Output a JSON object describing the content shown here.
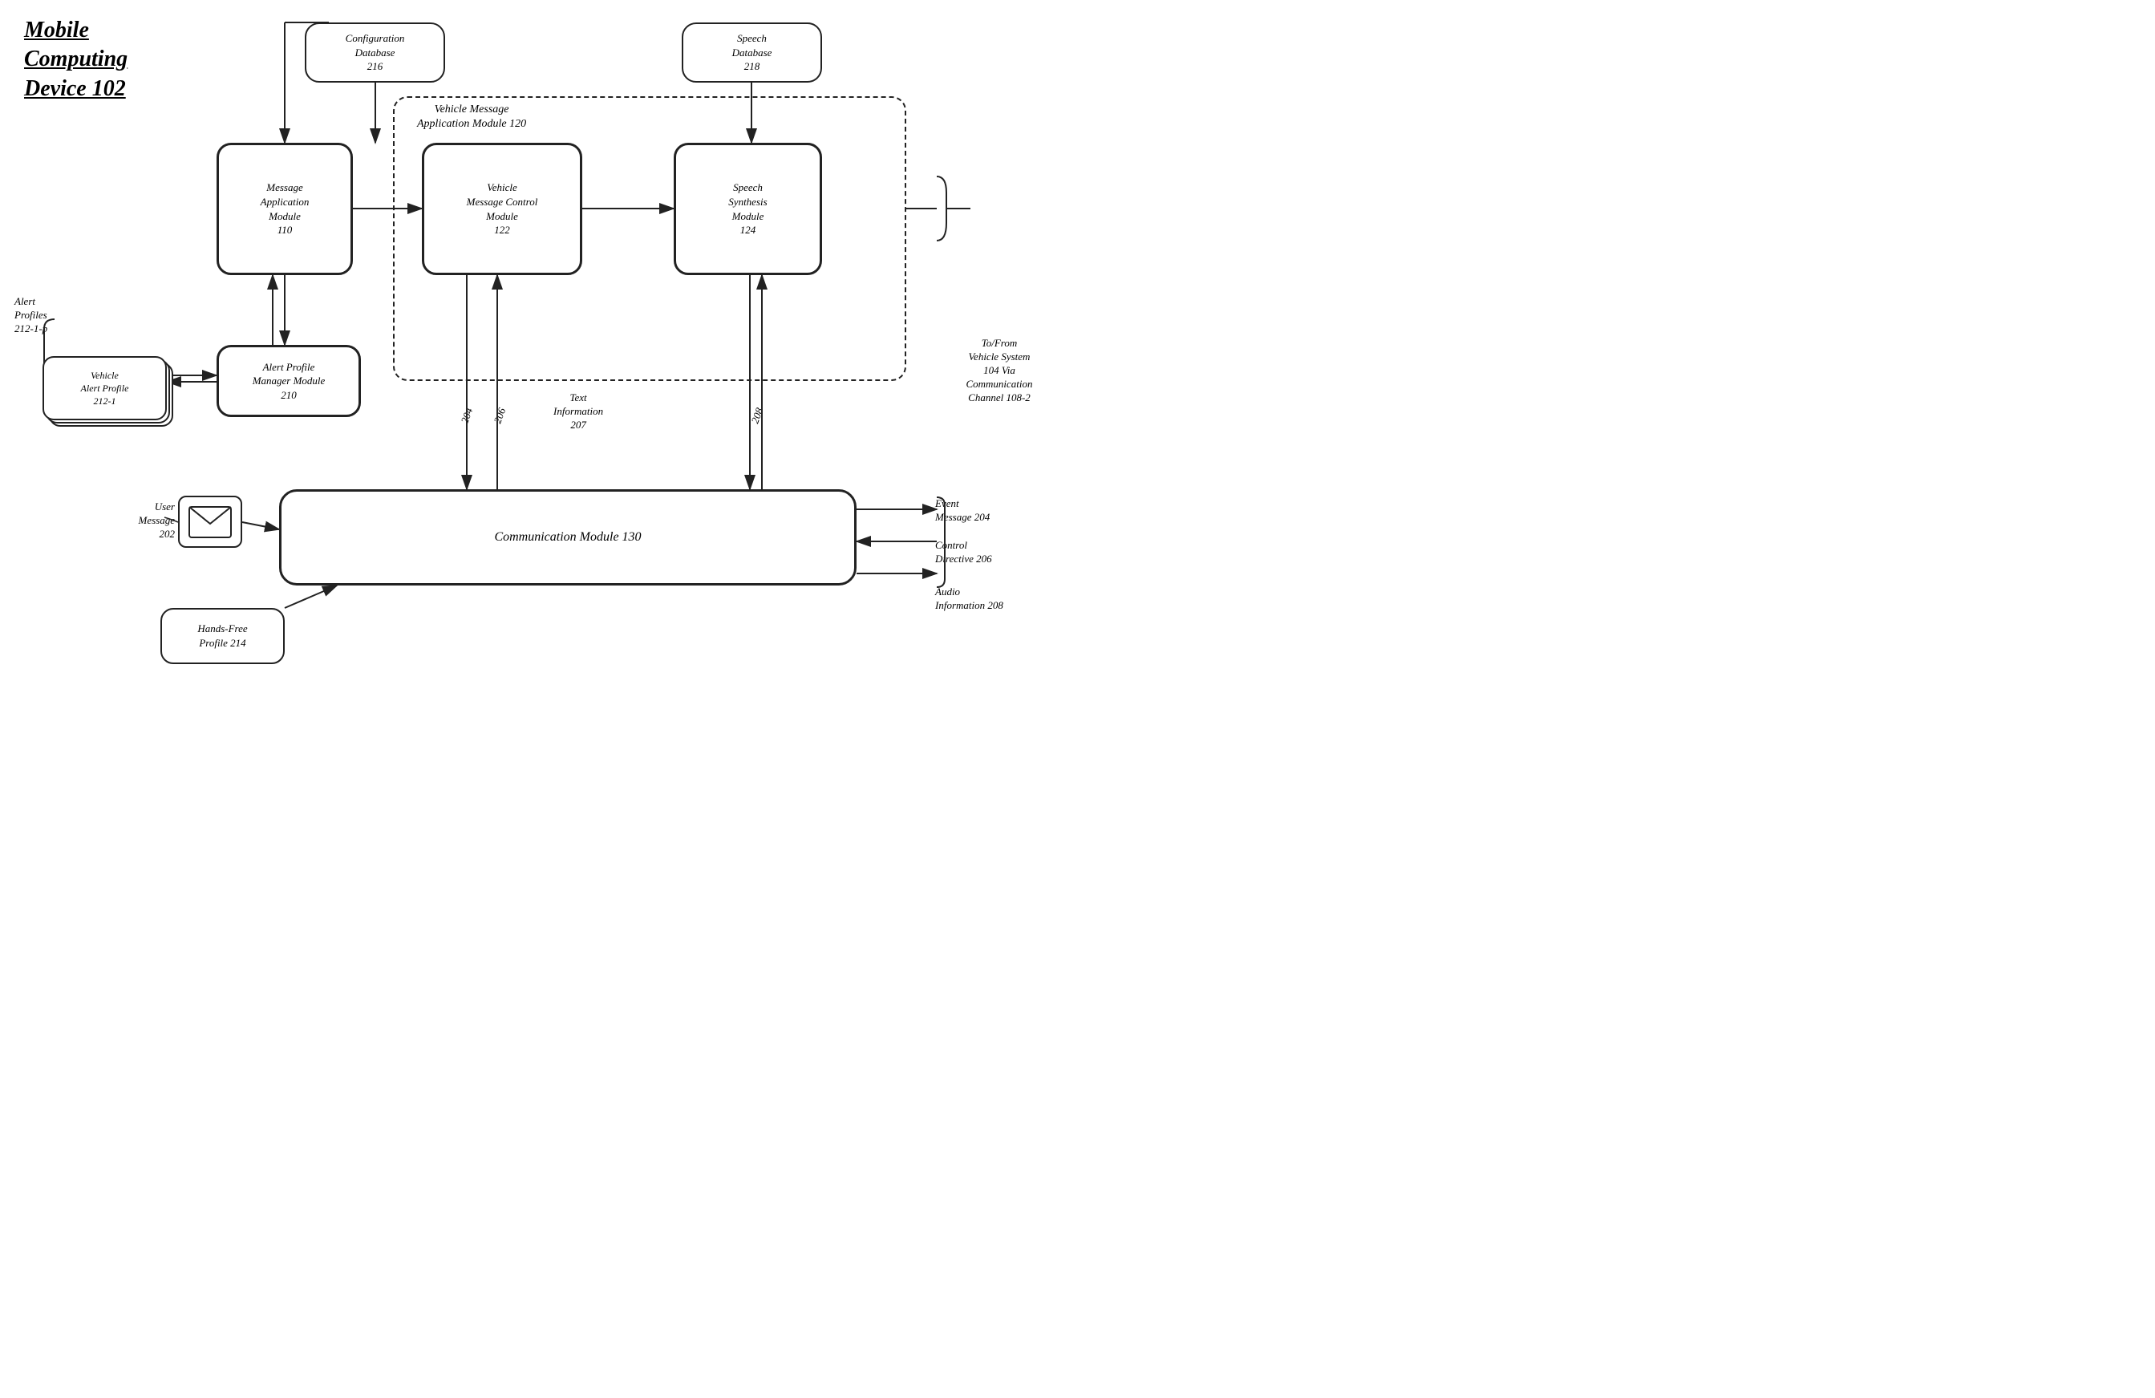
{
  "title": {
    "line1": "Mobile",
    "line2": "Computing",
    "line3": "Device 102"
  },
  "boxes": {
    "config_db": {
      "label": "Configuration\nDatabase\n216"
    },
    "speech_db": {
      "label": "Speech\nDatabase\n218"
    },
    "msg_app": {
      "label": "Message\nApplication\nModule\n110"
    },
    "vm_control": {
      "label": "Vehicle\nMessage Control\nModule\n122"
    },
    "speech_synth": {
      "label": "Speech\nSynthesis\nModule\n124"
    },
    "alert_profile_mgr": {
      "label": "Alert Profile\nManager Module\n210"
    },
    "vehicle_alert_profile": {
      "label": "Vehicle\nAlert Profile\n212-1"
    },
    "comm_module": {
      "label": "Communication Module 130"
    },
    "hands_free": {
      "label": "Hands-Free\nProfile 214"
    },
    "vehicle_msg_app_dashed": {
      "label": "Vehicle Message\nApplication Module 120"
    }
  },
  "labels": {
    "alert_profiles": "Alert\nProfiles\n212-1-p",
    "user_message": "User\nMessage\n202",
    "text_info": "Text\nInformation\n207",
    "arrow_204": "204",
    "arrow_206": "206",
    "arrow_208": "208",
    "to_from": "To/From\nVehicle System\n104 Via\nCommunication\nChannel 108-2",
    "event_msg": "Event\nMessage 204",
    "control_dir": "Control\nDirective 206",
    "audio_info": "Audio\nInformation 208"
  }
}
